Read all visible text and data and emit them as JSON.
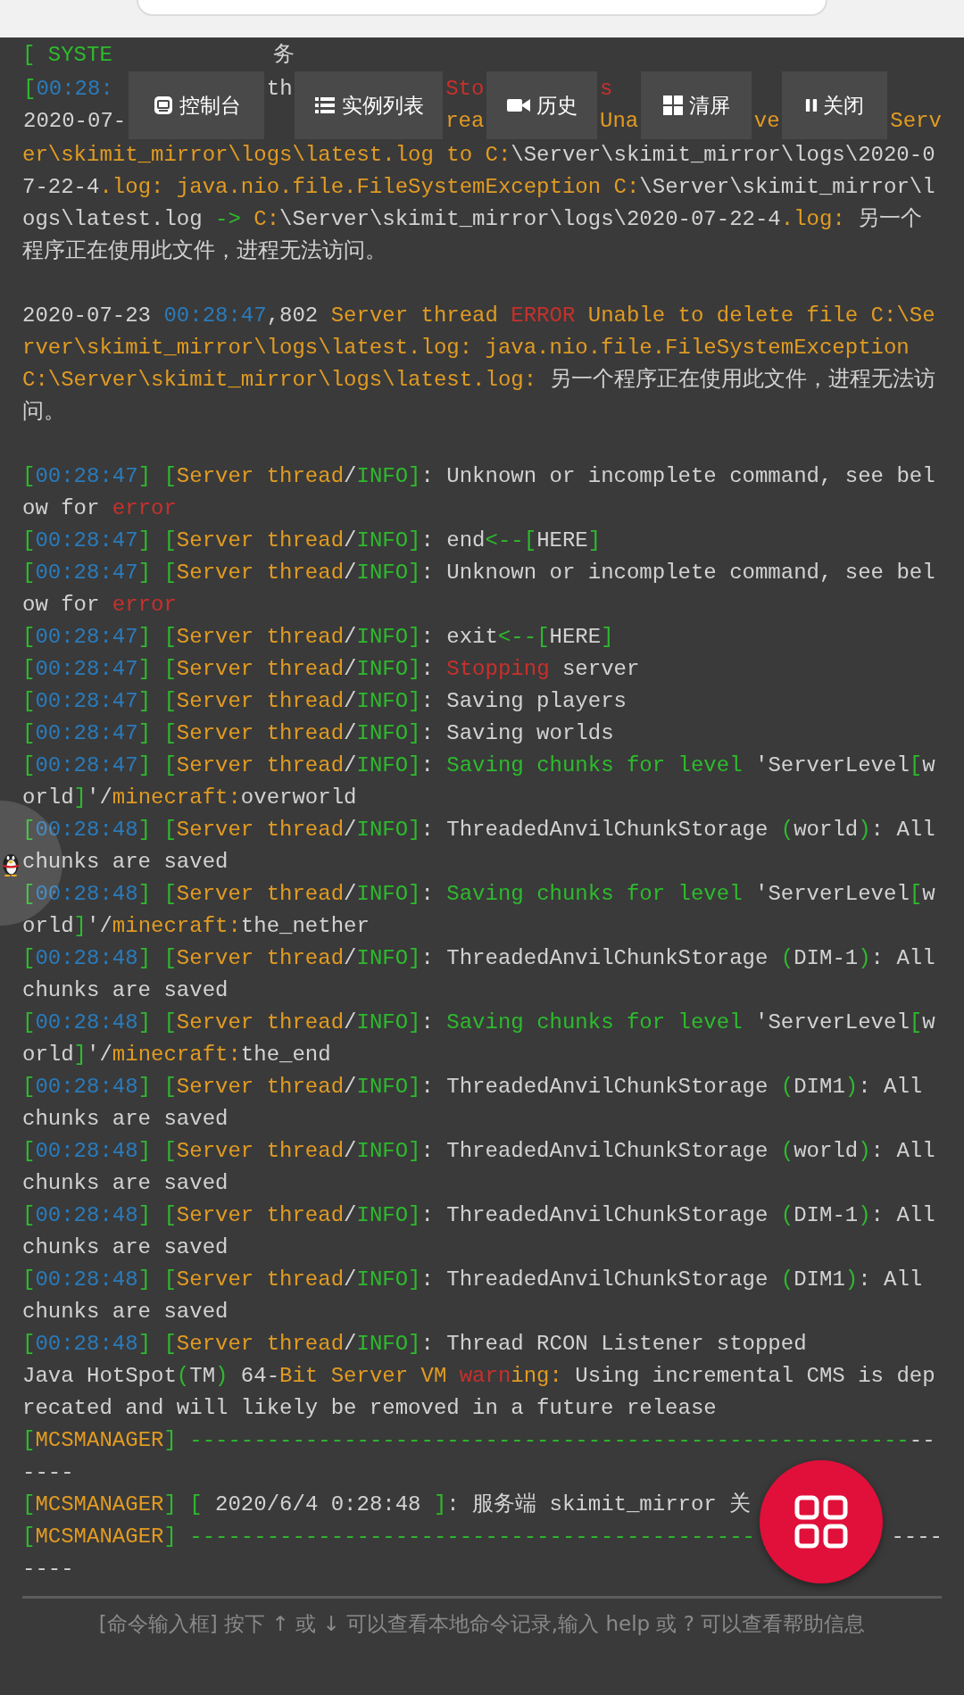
{
  "log": [
    {
      "kind": "fragments",
      "items": [
        {
          "segments": [
            {
              "kind": "tag",
              "text": "[ SYSTE"
            }
          ]
        },
        {
          "segments": [
            {
              "kind": "plain",
              "text": "务"
            }
          ]
        }
      ]
    },
    {
      "kind": "strip",
      "items": [
        {
          "kind": "text",
          "upper": [
            {
              "kind": "tag",
              "text": "["
            },
            {
              "kind": "time",
              "text": "00:28:"
            }
          ],
          "lower": [
            {
              "kind": "plain",
              "text": "2020-07-"
            }
          ]
        },
        {
          "kind": "button",
          "label": "控制台"
        },
        {
          "kind": "text",
          "upper": [
            {
              "kind": "plain",
              "text": "th"
            }
          ]
        },
        {
          "kind": "button",
          "label": "实例列表"
        },
        {
          "kind": "text",
          "upper": [
            {
              "kind": "alert",
              "text": "Sto"
            }
          ],
          "lower": [
            {
              "kind": "source",
              "text": "rea"
            }
          ]
        },
        {
          "kind": "button",
          "label": "历史"
        },
        {
          "kind": "text",
          "upper": [
            {
              "kind": "alert",
              "text": "s"
            }
          ],
          "lower": [
            {
              "kind": "source",
              "text": "Una"
            }
          ]
        },
        {
          "kind": "button",
          "label": "清屏"
        },
        {
          "kind": "text",
          "lower": [
            {
              "kind": "source",
              "text": "ve"
            }
          ]
        },
        {
          "kind": "button",
          "label": "关闭"
        },
        {
          "kind": "text",
          "lower": [
            {
              "kind": "source",
              "text": "Serv"
            }
          ]
        }
      ]
    },
    {
      "kind": "line",
      "segments": [
        {
          "kind": "source",
          "text": "er\\skimit_mirror\\logs\\latest.log to C:"
        },
        {
          "kind": "plain",
          "text": "\\Server\\skimit_mirror\\logs\\2020-07-22-4"
        },
        {
          "kind": "source",
          "text": ".log: java.nio.file.FileSystemException C:"
        },
        {
          "kind": "plain",
          "text": "\\Server\\skimit_mirror\\logs\\latest.log "
        },
        {
          "kind": "tag",
          "text": "->"
        },
        {
          "kind": "source",
          "text": " C:"
        },
        {
          "kind": "plain",
          "text": "\\Server\\skimit_mirror\\logs\\2020-07-22-4"
        },
        {
          "kind": "source",
          "text": ".log: "
        },
        {
          "kind": "plain",
          "text": "另一个程序正在使用此文件，进程无法访问。"
        }
      ]
    },
    {
      "kind": "blank"
    },
    {
      "kind": "line",
      "segments": [
        {
          "kind": "plain",
          "text": "2020-07-23 "
        },
        {
          "kind": "time",
          "text": "00:28:47"
        },
        {
          "kind": "plain",
          "text": ",802 "
        },
        {
          "kind": "source",
          "text": "Server thread "
        },
        {
          "kind": "alert",
          "text": "ERROR"
        },
        {
          "kind": "source",
          "text": " Unable to delete file C:\\Server\\skimit_mirror\\logs\\latest.log: java.nio.file.FileSystemException C:\\Server\\skimit_mirror\\logs\\latest.log: "
        },
        {
          "kind": "plain",
          "text": "另一个程序正在使用此文件，进程无法访问。"
        }
      ]
    },
    {
      "kind": "blank"
    },
    {
      "kind": "line",
      "segments": [
        {
          "kind": "tag",
          "text": "["
        },
        {
          "kind": "time",
          "text": "00:28:47"
        },
        {
          "kind": "tag",
          "text": "] ["
        },
        {
          "kind": "source",
          "text": "Server thread"
        },
        {
          "kind": "plain",
          "text": "/"
        },
        {
          "kind": "tag",
          "text": "INFO]"
        },
        {
          "kind": "plain",
          "text": ": Unknown or incomplete command, see below for "
        },
        {
          "kind": "alert",
          "text": "error"
        }
      ]
    },
    {
      "kind": "line",
      "segments": [
        {
          "kind": "tag",
          "text": "["
        },
        {
          "kind": "time",
          "text": "00:28:47"
        },
        {
          "kind": "tag",
          "text": "] ["
        },
        {
          "kind": "source",
          "text": "Server thread"
        },
        {
          "kind": "plain",
          "text": "/"
        },
        {
          "kind": "tag",
          "text": "INFO]"
        },
        {
          "kind": "plain",
          "text": ": end"
        },
        {
          "kind": "tag",
          "text": "<--["
        },
        {
          "kind": "plain",
          "text": "HERE"
        },
        {
          "kind": "tag",
          "text": "]"
        }
      ]
    },
    {
      "kind": "line",
      "segments": [
        {
          "kind": "tag",
          "text": "["
        },
        {
          "kind": "time",
          "text": "00:28:47"
        },
        {
          "kind": "tag",
          "text": "] ["
        },
        {
          "kind": "source",
          "text": "Server thread"
        },
        {
          "kind": "plain",
          "text": "/"
        },
        {
          "kind": "tag",
          "text": "INFO]"
        },
        {
          "kind": "plain",
          "text": ": Unknown or incomplete command, see below for "
        },
        {
          "kind": "alert",
          "text": "error"
        }
      ]
    },
    {
      "kind": "line",
      "segments": [
        {
          "kind": "tag",
          "text": "["
        },
        {
          "kind": "time",
          "text": "00:28:47"
        },
        {
          "kind": "tag",
          "text": "] ["
        },
        {
          "kind": "source",
          "text": "Server thread"
        },
        {
          "kind": "plain",
          "text": "/"
        },
        {
          "kind": "tag",
          "text": "INFO]"
        },
        {
          "kind": "plain",
          "text": ": exit"
        },
        {
          "kind": "tag",
          "text": "<--["
        },
        {
          "kind": "plain",
          "text": "HERE"
        },
        {
          "kind": "tag",
          "text": "]"
        }
      ]
    },
    {
      "kind": "line",
      "segments": [
        {
          "kind": "tag",
          "text": "["
        },
        {
          "kind": "time",
          "text": "00:28:47"
        },
        {
          "kind": "tag",
          "text": "] ["
        },
        {
          "kind": "source",
          "text": "Server thread"
        },
        {
          "kind": "plain",
          "text": "/"
        },
        {
          "kind": "tag",
          "text": "INFO]"
        },
        {
          "kind": "plain",
          "text": ": "
        },
        {
          "kind": "alert",
          "text": "Stopping"
        },
        {
          "kind": "plain",
          "text": " server"
        }
      ]
    },
    {
      "kind": "line",
      "segments": [
        {
          "kind": "tag",
          "text": "["
        },
        {
          "kind": "time",
          "text": "00:28:47"
        },
        {
          "kind": "tag",
          "text": "] ["
        },
        {
          "kind": "source",
          "text": "Server thread"
        },
        {
          "kind": "plain",
          "text": "/"
        },
        {
          "kind": "tag",
          "text": "INFO]"
        },
        {
          "kind": "plain",
          "text": ": Saving players"
        }
      ]
    },
    {
      "kind": "line",
      "segments": [
        {
          "kind": "tag",
          "text": "["
        },
        {
          "kind": "time",
          "text": "00:28:47"
        },
        {
          "kind": "tag",
          "text": "] ["
        },
        {
          "kind": "source",
          "text": "Server thread"
        },
        {
          "kind": "plain",
          "text": "/"
        },
        {
          "kind": "tag",
          "text": "INFO]"
        },
        {
          "kind": "plain",
          "text": ": Saving worlds"
        }
      ]
    },
    {
      "kind": "line",
      "segments": [
        {
          "kind": "tag",
          "text": "["
        },
        {
          "kind": "time",
          "text": "00:28:47"
        },
        {
          "kind": "tag",
          "text": "] ["
        },
        {
          "kind": "source",
          "text": "Server thread"
        },
        {
          "kind": "plain",
          "text": "/"
        },
        {
          "kind": "tag",
          "text": "INFO]"
        },
        {
          "kind": "plain",
          "text": ": "
        },
        {
          "kind": "tag",
          "text": "Saving chunks for level"
        },
        {
          "kind": "plain",
          "text": " 'ServerLevel"
        },
        {
          "kind": "tag",
          "text": "["
        },
        {
          "kind": "plain",
          "text": "world"
        },
        {
          "kind": "tag",
          "text": "]"
        },
        {
          "kind": "plain",
          "text": "'/"
        },
        {
          "kind": "source",
          "text": "minecraft:"
        },
        {
          "kind": "plain",
          "text": "overworld"
        }
      ]
    },
    {
      "kind": "line",
      "segments": [
        {
          "kind": "tag",
          "text": "["
        },
        {
          "kind": "time",
          "text": "00:28:48"
        },
        {
          "kind": "tag",
          "text": "] ["
        },
        {
          "kind": "source",
          "text": "Server thread"
        },
        {
          "kind": "plain",
          "text": "/"
        },
        {
          "kind": "tag",
          "text": "INFO]"
        },
        {
          "kind": "plain",
          "text": ": ThreadedAnvilChunkStorage "
        },
        {
          "kind": "tag",
          "text": "("
        },
        {
          "kind": "plain",
          "text": "world"
        },
        {
          "kind": "tag",
          "text": ")"
        },
        {
          "kind": "plain",
          "text": ": All chunks are saved"
        }
      ]
    },
    {
      "kind": "line",
      "segments": [
        {
          "kind": "tag",
          "text": "["
        },
        {
          "kind": "time",
          "text": "00:28:48"
        },
        {
          "kind": "tag",
          "text": "] ["
        },
        {
          "kind": "source",
          "text": "Server thread"
        },
        {
          "kind": "plain",
          "text": "/"
        },
        {
          "kind": "tag",
          "text": "INFO]"
        },
        {
          "kind": "plain",
          "text": ": "
        },
        {
          "kind": "tag",
          "text": "Saving chunks for level"
        },
        {
          "kind": "plain",
          "text": " 'ServerLevel"
        },
        {
          "kind": "tag",
          "text": "["
        },
        {
          "kind": "plain",
          "text": "world"
        },
        {
          "kind": "tag",
          "text": "]"
        },
        {
          "kind": "plain",
          "text": "'/"
        },
        {
          "kind": "source",
          "text": "minecraft:"
        },
        {
          "kind": "plain",
          "text": "the_nether"
        }
      ]
    },
    {
      "kind": "line",
      "segments": [
        {
          "kind": "tag",
          "text": "["
        },
        {
          "kind": "time",
          "text": "00:28:48"
        },
        {
          "kind": "tag",
          "text": "] ["
        },
        {
          "kind": "source",
          "text": "Server thread"
        },
        {
          "kind": "plain",
          "text": "/"
        },
        {
          "kind": "tag",
          "text": "INFO]"
        },
        {
          "kind": "plain",
          "text": ": ThreadedAnvilChunkStorage "
        },
        {
          "kind": "tag",
          "text": "("
        },
        {
          "kind": "plain",
          "text": "DIM-1"
        },
        {
          "kind": "tag",
          "text": ")"
        },
        {
          "kind": "plain",
          "text": ": All chunks are saved"
        }
      ]
    },
    {
      "kind": "line",
      "segments": [
        {
          "kind": "tag",
          "text": "["
        },
        {
          "kind": "time",
          "text": "00:28:48"
        },
        {
          "kind": "tag",
          "text": "] ["
        },
        {
          "kind": "source",
          "text": "Server thread"
        },
        {
          "kind": "plain",
          "text": "/"
        },
        {
          "kind": "tag",
          "text": "INFO]"
        },
        {
          "kind": "plain",
          "text": ": "
        },
        {
          "kind": "tag",
          "text": "Saving chunks for level"
        },
        {
          "kind": "plain",
          "text": " 'ServerLevel"
        },
        {
          "kind": "tag",
          "text": "["
        },
        {
          "kind": "plain",
          "text": "world"
        },
        {
          "kind": "tag",
          "text": "]"
        },
        {
          "kind": "plain",
          "text": "'/"
        },
        {
          "kind": "source",
          "text": "minecraft:"
        },
        {
          "kind": "plain",
          "text": "the_end"
        }
      ]
    },
    {
      "kind": "line",
      "segments": [
        {
          "kind": "tag",
          "text": "["
        },
        {
          "kind": "time",
          "text": "00:28:48"
        },
        {
          "kind": "tag",
          "text": "] ["
        },
        {
          "kind": "source",
          "text": "Server thread"
        },
        {
          "kind": "plain",
          "text": "/"
        },
        {
          "kind": "tag",
          "text": "INFO]"
        },
        {
          "kind": "plain",
          "text": ": ThreadedAnvilChunkStorage "
        },
        {
          "kind": "tag",
          "text": "("
        },
        {
          "kind": "plain",
          "text": "DIM1"
        },
        {
          "kind": "tag",
          "text": ")"
        },
        {
          "kind": "plain",
          "text": ": All chunks are saved"
        }
      ]
    },
    {
      "kind": "line",
      "segments": [
        {
          "kind": "tag",
          "text": "["
        },
        {
          "kind": "time",
          "text": "00:28:48"
        },
        {
          "kind": "tag",
          "text": "] ["
        },
        {
          "kind": "source",
          "text": "Server thread"
        },
        {
          "kind": "plain",
          "text": "/"
        },
        {
          "kind": "tag",
          "text": "INFO]"
        },
        {
          "kind": "plain",
          "text": ": ThreadedAnvilChunkStorage "
        },
        {
          "kind": "tag",
          "text": "("
        },
        {
          "kind": "plain",
          "text": "world"
        },
        {
          "kind": "tag",
          "text": ")"
        },
        {
          "kind": "plain",
          "text": ": All chunks are saved"
        }
      ]
    },
    {
      "kind": "line",
      "segments": [
        {
          "kind": "tag",
          "text": "["
        },
        {
          "kind": "time",
          "text": "00:28:48"
        },
        {
          "kind": "tag",
          "text": "] ["
        },
        {
          "kind": "source",
          "text": "Server thread"
        },
        {
          "kind": "plain",
          "text": "/"
        },
        {
          "kind": "tag",
          "text": "INFO]"
        },
        {
          "kind": "plain",
          "text": ": ThreadedAnvilChunkStorage "
        },
        {
          "kind": "tag",
          "text": "("
        },
        {
          "kind": "plain",
          "text": "DIM-1"
        },
        {
          "kind": "tag",
          "text": ")"
        },
        {
          "kind": "plain",
          "text": ": All chunks are saved"
        }
      ]
    },
    {
      "kind": "line",
      "segments": [
        {
          "kind": "tag",
          "text": "["
        },
        {
          "kind": "time",
          "text": "00:28:48"
        },
        {
          "kind": "tag",
          "text": "] ["
        },
        {
          "kind": "source",
          "text": "Server thread"
        },
        {
          "kind": "plain",
          "text": "/"
        },
        {
          "kind": "tag",
          "text": "INFO]"
        },
        {
          "kind": "plain",
          "text": ": ThreadedAnvilChunkStorage "
        },
        {
          "kind": "tag",
          "text": "("
        },
        {
          "kind": "plain",
          "text": "DIM1"
        },
        {
          "kind": "tag",
          "text": ")"
        },
        {
          "kind": "plain",
          "text": ": All chunks are saved"
        }
      ]
    },
    {
      "kind": "line",
      "segments": [
        {
          "kind": "tag",
          "text": "["
        },
        {
          "kind": "time",
          "text": "00:28:48"
        },
        {
          "kind": "tag",
          "text": "] ["
        },
        {
          "kind": "source",
          "text": "Server thread"
        },
        {
          "kind": "plain",
          "text": "/"
        },
        {
          "kind": "tag",
          "text": "INFO]"
        },
        {
          "kind": "plain",
          "text": ": Thread RCON Listener stopped"
        }
      ]
    },
    {
      "kind": "line",
      "segments": [
        {
          "kind": "plain",
          "text": "Java HotSpot"
        },
        {
          "kind": "tag",
          "text": "("
        },
        {
          "kind": "plain",
          "text": "TM"
        },
        {
          "kind": "tag",
          "text": ")"
        },
        {
          "kind": "plain",
          "text": " 64-"
        },
        {
          "kind": "source",
          "text": "Bit Server VM "
        },
        {
          "kind": "alert",
          "text": "warn"
        },
        {
          "kind": "source",
          "text": "ing:"
        },
        {
          "kind": "plain",
          "text": " Using incremental CMS is deprecated and will likely be removed in a future release"
        }
      ]
    },
    {
      "kind": "line",
      "segments": [
        {
          "kind": "tag",
          "text": "["
        },
        {
          "kind": "source",
          "text": "MCSMANAGER"
        },
        {
          "kind": "tag",
          "text": "] --------------------------------------------------------"
        },
        {
          "kind": "plain",
          "text": "------"
        }
      ]
    },
    {
      "kind": "line",
      "segments": [
        {
          "kind": "tag",
          "text": "["
        },
        {
          "kind": "source",
          "text": "MCSMANAGER"
        },
        {
          "kind": "tag",
          "text": "] ["
        },
        {
          "kind": "plain",
          "text": " 2020/6/4 0:28:48 "
        },
        {
          "kind": "tag",
          "text": "]"
        },
        {
          "kind": "plain",
          "text": ": 服务端 skimit_mirror 关"
        }
      ]
    },
    {
      "kind": "split",
      "items": [
        {
          "segments": [
            {
              "kind": "tag",
              "text": "["
            },
            {
              "kind": "source",
              "text": "MCSMANAGER"
            },
            {
              "kind": "tag",
              "text": "] --------------------------------------------"
            }
          ]
        },
        {
          "segments": [
            {
              "kind": "plain",
              "text": "----"
            }
          ]
        }
      ]
    },
    {
      "kind": "line",
      "segments": [
        {
          "kind": "plain",
          "text": "----"
        }
      ]
    }
  ],
  "command_input": {
    "placeholder": "[命令输入框] 按下 ↑ 或 ↓ 可以查看本地命令记录,输入 help 或 ? 可以查看帮助信息"
  }
}
